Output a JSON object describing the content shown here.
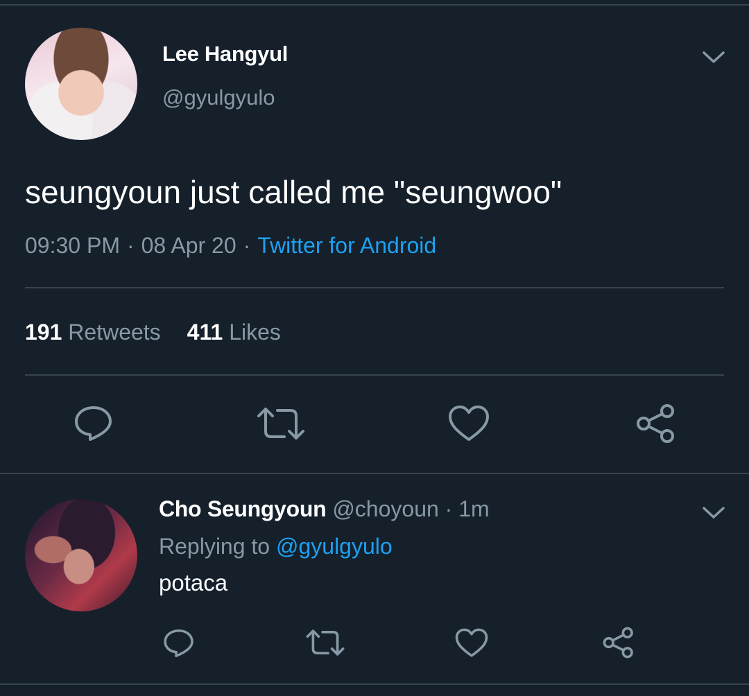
{
  "tweet": {
    "author_name": "Lee Hangyul",
    "author_handle": "@gyulgyulo",
    "text": "seungyoun just called me \"seungwoo\"",
    "time": "09:30 PM",
    "date": "08 Apr 20",
    "separator": "·",
    "source": "Twitter for Android",
    "retweets_count": "191",
    "retweets_label": "Retweets",
    "likes_count": "411",
    "likes_label": "Likes"
  },
  "reply": {
    "author_name": "Cho Seungyoun",
    "author_handle": "@choyoun",
    "separator": "·",
    "age": "1m",
    "replying_prefix": "Replying to",
    "replying_handle": "@gyulgyulo",
    "text": "potaca"
  },
  "icons": {
    "reply": "reply-icon",
    "retweet": "retweet-icon",
    "like": "heart-icon",
    "share": "share-icon",
    "menu": "chevron-down-icon"
  },
  "colors": {
    "background": "#15202b",
    "divider": "#38444d",
    "secondary_text": "#8899a6",
    "link": "#1da1f2",
    "primary_text": "#ffffff"
  }
}
